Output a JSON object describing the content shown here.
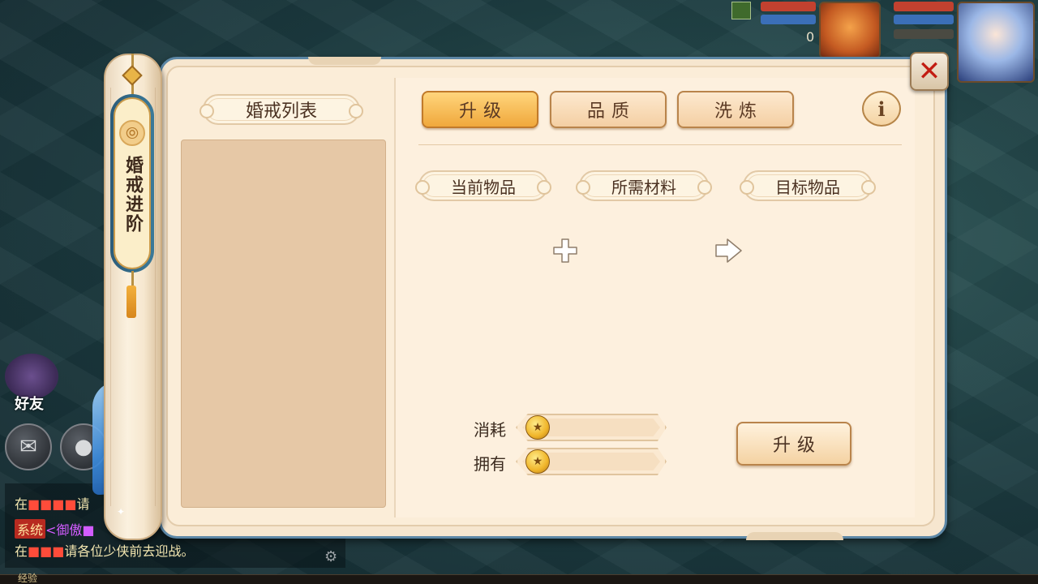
{
  "panel": {
    "side_title": "婚戒进阶",
    "list_title": "婚戒列表",
    "tabs": [
      {
        "label": "升级",
        "active": true
      },
      {
        "label": "品质",
        "active": false
      },
      {
        "label": "洗炼",
        "active": false
      }
    ],
    "slots": {
      "current": "当前物品",
      "material": "所需材料",
      "target": "目标物品"
    },
    "cost": {
      "consume_label": "消耗",
      "own_label": "拥有",
      "consume_value": "",
      "own_value": ""
    },
    "upgrade_button": "升级",
    "info_glyph": "i",
    "close_glyph": "✕"
  },
  "hud": {
    "friend_label": "好友",
    "top_number": "0",
    "chat": [
      {
        "prefix": "在",
        "place": "■■■■",
        "suffix": "请"
      },
      {
        "tag": "系统",
        "text": "<御傲■"
      },
      {
        "prefix": "在",
        "place": "■■■",
        "suffix": "请各位少侠前去迎战。"
      }
    ],
    "exp_label": "经验"
  },
  "colors": {
    "tab_active": "#f0a83c",
    "tab_inactive": "#f4cfa3",
    "panel_bg": "#fbedd8",
    "frame_blue": "#5c87a6",
    "close_red": "#c21d12"
  }
}
